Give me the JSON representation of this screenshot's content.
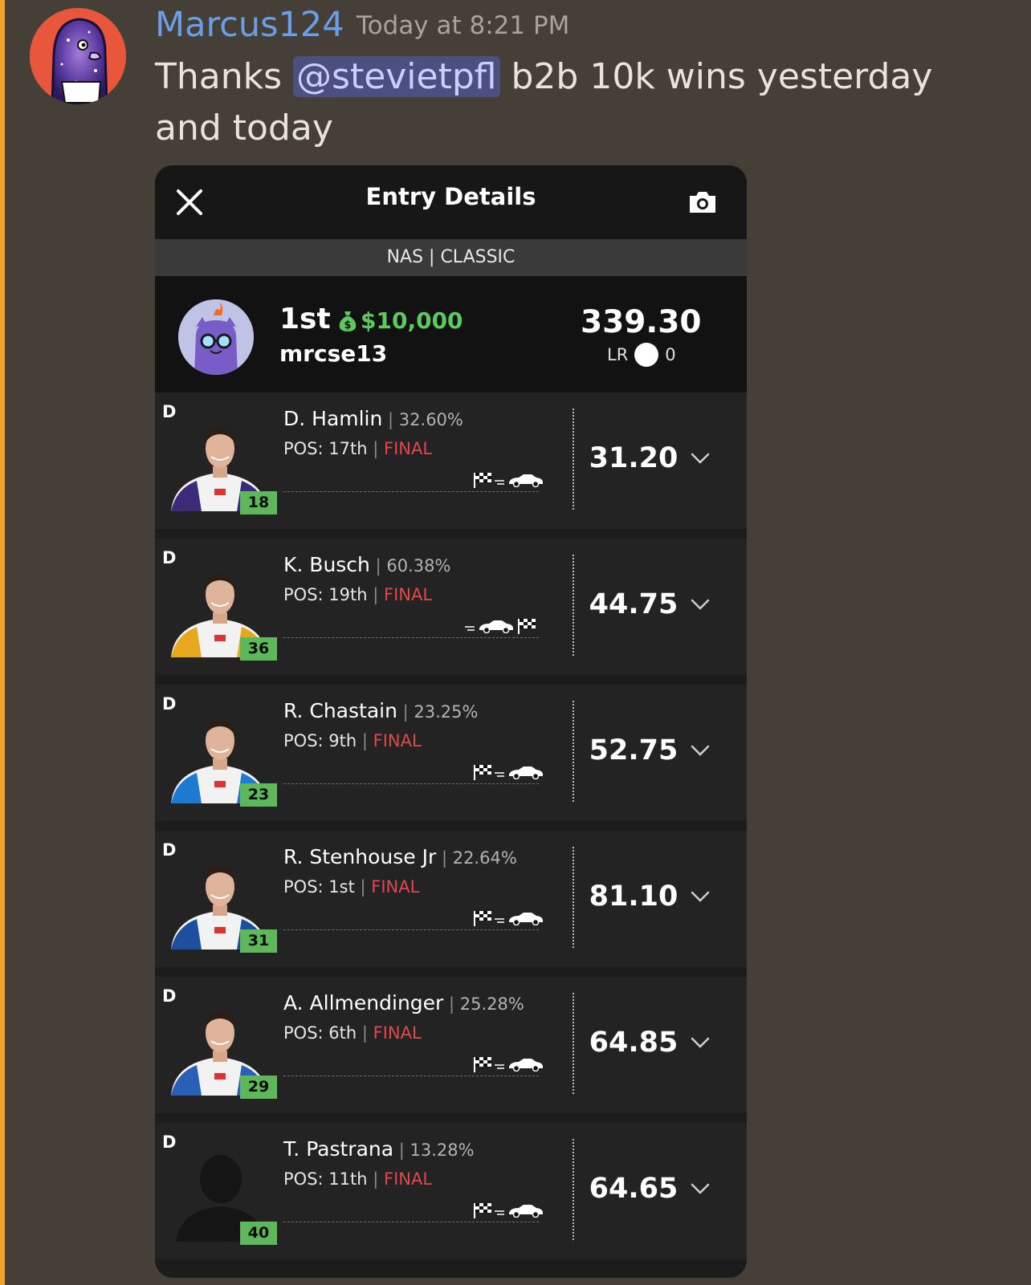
{
  "message": {
    "author": "Marcus124",
    "timestamp": "Today at 8:21 PM",
    "text_before": "Thanks ",
    "mention": "@stevietpfl",
    "text_after": " b2b 10k wins yesterday and today"
  },
  "card": {
    "title": "Entry Details",
    "contest": "NAS | CLASSIC",
    "rank": "1st",
    "prize": "$10,000",
    "user": "mrcse13",
    "score": "339.30",
    "lr_label": "LR",
    "lr_value": "0"
  },
  "players": [
    {
      "pos": "D",
      "name": "D. Hamlin",
      "own": "32.60%",
      "finish": "POS: 17th",
      "status": "FINAL",
      "number": "18",
      "points": "31.20",
      "flag_first": true
    },
    {
      "pos": "D",
      "name": "K. Busch",
      "own": "60.38%",
      "finish": "POS: 19th",
      "status": "FINAL",
      "number": "36",
      "points": "44.75",
      "flag_first": false
    },
    {
      "pos": "D",
      "name": "R. Chastain",
      "own": "23.25%",
      "finish": "POS: 9th",
      "status": "FINAL",
      "number": "23",
      "points": "52.75",
      "flag_first": true
    },
    {
      "pos": "D",
      "name": "R. Stenhouse Jr",
      "own": "22.64%",
      "finish": "POS: 1st",
      "status": "FINAL",
      "number": "31",
      "points": "81.10",
      "flag_first": true
    },
    {
      "pos": "D",
      "name": "A. Allmendinger",
      "own": "25.28%",
      "finish": "POS: 6th",
      "status": "FINAL",
      "number": "29",
      "points": "64.85",
      "flag_first": true
    },
    {
      "pos": "D",
      "name": "T. Pastrana",
      "own": "13.28%",
      "finish": "POS: 11th",
      "status": "FINAL",
      "number": "40",
      "points": "64.65",
      "flag_first": true
    }
  ],
  "colors": {
    "background": "#463f37",
    "accent_bar": "#f0a232",
    "username": "#6b9ee8",
    "prize_green": "#5ec95f",
    "final_red": "#e2484b",
    "number_badge": "#5db85a"
  },
  "icons": {
    "close": "close-icon",
    "camera": "camera-icon",
    "money_bag": "money-bag-icon",
    "checkered_flag": "checkered-flag-icon",
    "car": "race-car-icon",
    "chevron": "chevron-down-icon"
  }
}
